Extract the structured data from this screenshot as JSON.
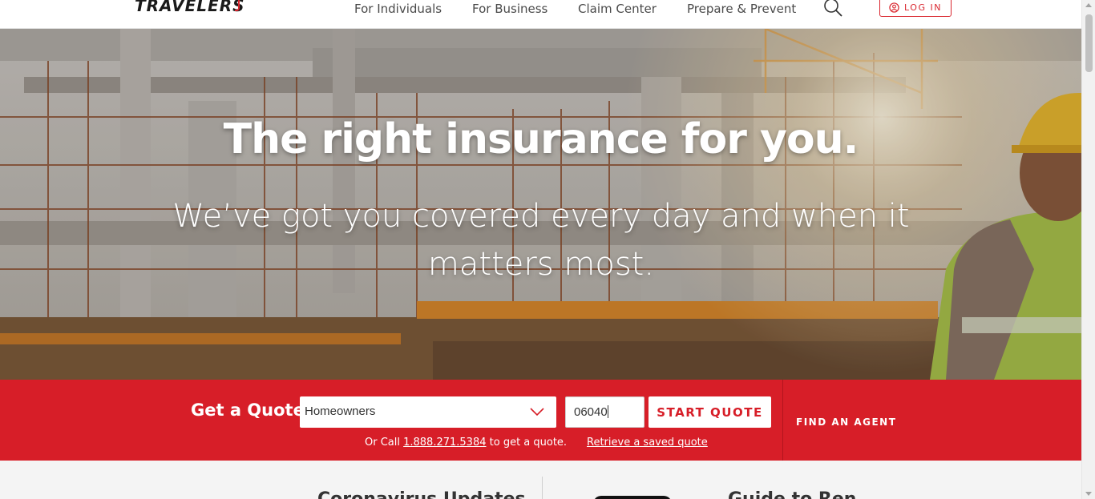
{
  "header": {
    "logo_text": "TRAVELERS",
    "nav": [
      "For Individuals",
      "For Business",
      "Claim Center",
      "Prepare & Prevent"
    ],
    "login_label": "LOG IN"
  },
  "hero": {
    "title": "The right insurance for you.",
    "subtitle": "We’ve got you covered every day and when it matters most."
  },
  "quote": {
    "label": "Get a Quote",
    "product_selected": "Homeowners",
    "zip_value": "06040",
    "start_label": "START QUOTE",
    "call_prefix": "Or Call ",
    "phone": "1.888.271.5384",
    "call_suffix": " to get a quote.",
    "retrieve_label": "Retrieve a saved quote",
    "find_agent_label": "FIND AN AGENT"
  },
  "below": {
    "left_heading_peek": "Coronavirus Updates",
    "right_heading_peek": "Guide to Ren"
  },
  "colors": {
    "brand_red": "#d71e28",
    "text_dark": "#4a4a4a"
  },
  "icons": [
    "search-icon",
    "user-circle-icon",
    "chevron-down-icon"
  ]
}
